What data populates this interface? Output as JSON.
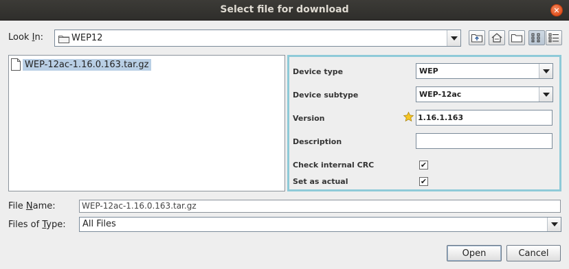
{
  "window": {
    "title": "Select file for download"
  },
  "toolbar": {
    "look_in_label_pre": "Look ",
    "look_in_label_u": "I",
    "look_in_label_post": "n:",
    "current_folder": "WEP12",
    "buttons": [
      "up-one-level-icon",
      "home-icon",
      "new-folder-icon",
      "list-view-icon",
      "details-view-icon"
    ]
  },
  "files": [
    {
      "name": "WEP-12ac-1.16.0.163.tar.gz",
      "selected": true
    }
  ],
  "properties": {
    "device_type_label": "Device type",
    "device_type_value": "WEP",
    "device_subtype_label": "Device subtype",
    "device_subtype_value": "WEP-12ac",
    "version_label": "Version",
    "version_value": "1.16.1.163",
    "description_label": "Description",
    "description_value": "",
    "check_crc_label": "Check internal CRC",
    "check_crc_checked": true,
    "set_actual_label": "Set as actual",
    "set_actual_checked": true
  },
  "footer": {
    "file_name_label_pre": "File ",
    "file_name_label_u": "N",
    "file_name_label_post": "ame:",
    "file_name_value": "WEP-12ac-1.16.0.163.tar.gz",
    "file_type_label_pre": "Files of ",
    "file_type_label_u": "T",
    "file_type_label_post": "ype:",
    "file_type_value": "All Files"
  },
  "buttons": {
    "open": "Open",
    "cancel": "Cancel"
  },
  "colors": {
    "titlebar": "#3c3b37",
    "close": "#e2521f",
    "accent_border": "#8ecad8",
    "selection": "#b9cfe5"
  }
}
